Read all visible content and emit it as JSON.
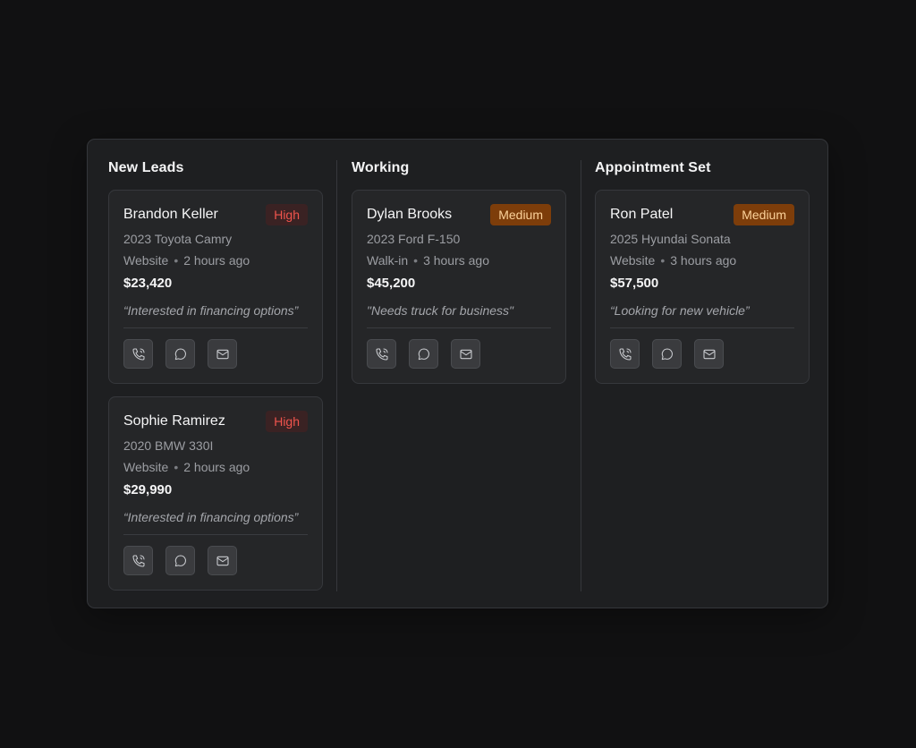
{
  "columns": [
    {
      "title": "New Leads",
      "cards": [
        {
          "name": "Brandon Keller",
          "priority": "High",
          "vehicle": "2023 Toyota Camry",
          "source": "Website",
          "time": "2 hours ago",
          "price": "$23,420",
          "note": "“Interested in financing options”"
        },
        {
          "name": "Sophie Ramirez",
          "priority": "High",
          "vehicle": "2020 BMW 330I",
          "source": "Website",
          "time": "2 hours ago",
          "price": "$29,990",
          "note": "“Interested in financing options”"
        }
      ]
    },
    {
      "title": "Working",
      "cards": [
        {
          "name": "Dylan Brooks",
          "priority": "Medium",
          "vehicle": "2023 Ford F-150",
          "source": "Walk-in",
          "time": "3 hours ago",
          "price": "$45,200",
          "note": "\"Needs truck for business\""
        }
      ]
    },
    {
      "title": "Appointment Set",
      "cards": [
        {
          "name": "Ron Patel",
          "priority": "Medium",
          "vehicle": "2025 Hyundai Sonata",
          "source": "Website",
          "time": "3 hours ago",
          "price": "$57,500",
          "note": "“Looking for new vehicle”"
        }
      ]
    }
  ],
  "separator": "•",
  "icons": {
    "call": "phone-icon",
    "message": "chat-bubble-icon",
    "email": "mail-icon"
  },
  "colors": {
    "high_text": "#f0544d",
    "high_bg": "#3a2223",
    "medium_text": "#fcd29a",
    "medium_bg": "#7d3d0a"
  }
}
